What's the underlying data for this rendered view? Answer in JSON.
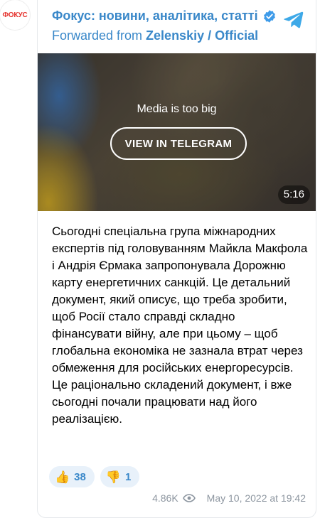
{
  "avatar": {
    "label": "ФОКУС"
  },
  "header": {
    "channel_title": "Фокус: новини, аналітика, статті",
    "forwarded_prefix": "Forwarded from ",
    "forwarded_source": "Zelenskiy / Official"
  },
  "media": {
    "notice": "Media is too big",
    "button_label": "VIEW IN TELEGRAM",
    "duration": "5:16"
  },
  "message": {
    "paragraph_1": "Сьогодні спеціальна група міжнародних експертів під головуванням Майкла Макфола і Андрія Єрмака запропонувала Дорожню карту енергетичних санкцій. Це детальний документ, який описує, що треба зробити, щоб Росії стало справді складно фінансувати війну, але при цьому – щоб глобальна економіка не зазнала втрат через обмеження для російських енергоресурсів.",
    "paragraph_2": "Це раціонально складений документ, і вже сьогодні почали працювати над його реалізацією."
  },
  "reactions": [
    {
      "emoji": "👍",
      "count": "38"
    },
    {
      "emoji": "👎",
      "count": "1"
    }
  ],
  "footer": {
    "views": "4.86K",
    "date": "May 10, 2022 at 19:42"
  },
  "colors": {
    "accent": "#3a88c9",
    "verified": "#3e9be9",
    "telegram": "#3ea9e8",
    "brand_red": "#e5322d",
    "reaction_bg": "#e8f1fa",
    "meta": "#8d96a0"
  },
  "icons": [
    "verified-icon",
    "telegram-icon",
    "eye-icon"
  ]
}
